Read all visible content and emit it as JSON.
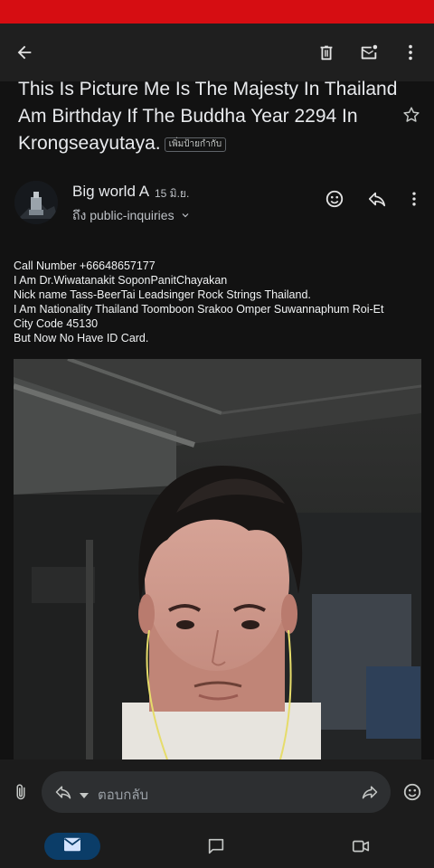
{
  "status_bar": {
    "text": ""
  },
  "toolbar": {
    "back_icon": "arrow-left-icon",
    "delete_icon": "trash-icon",
    "mark_unread_icon": "mail-unread-icon",
    "more_icon": "more-vert-icon"
  },
  "email": {
    "subject_line1": "This Is Picture Me Is The Majesty In Thailand",
    "subject_line2": "Am Birthday If The Buddha Year 2294 In",
    "subject_line3": "Krongseayutaya.",
    "label_chip": "เพิ่มป้ายกำกับ",
    "sender_name": "Big world A",
    "date": "15 มิ.ย.",
    "recipient": "ถึง public-inquiries",
    "body_lines": [
      "Call Number +66648657177",
      "I Am Dr.Wiwatanakit SoponPanitChayakan",
      "Nick name Tass-BeerTai Leadsinger Rock Strings Thailand.",
      "I Am Nationality Thailand Toomboon Srakoo Omper Suwannaphum Roi-Et",
      "City Code 45130",
      "But Now No Have ID Card."
    ]
  },
  "reply_bar": {
    "placeholder": "ตอบกลับ"
  },
  "colors": {
    "status_red": "#d60d12",
    "background": "#121212",
    "app_bar": "#1f1f1f",
    "nav_active": "#0b3d68",
    "icon_light": "#e3e3e3"
  }
}
